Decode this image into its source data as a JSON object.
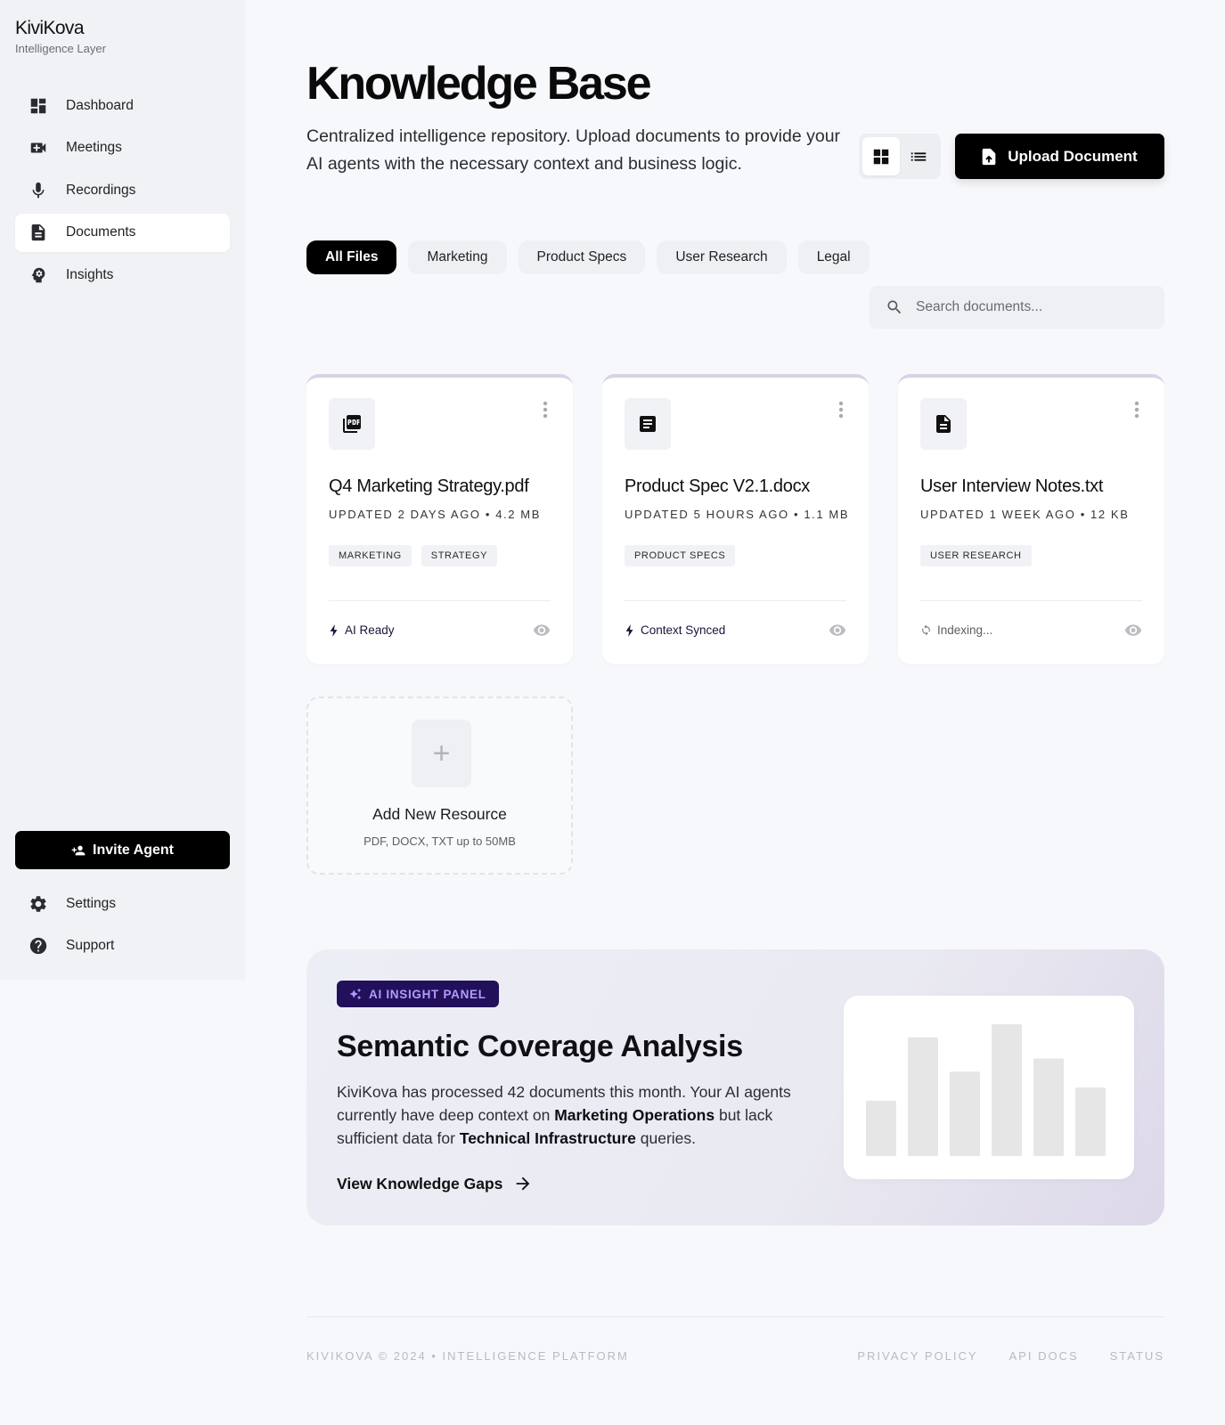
{
  "brand": {
    "name": "KiviKova",
    "tagline": "Intelligence Layer"
  },
  "sidebar": {
    "items": [
      {
        "label": "Dashboard",
        "icon": "dashboard-icon"
      },
      {
        "label": "Meetings",
        "icon": "video-icon"
      },
      {
        "label": "Recordings",
        "icon": "microphone-icon"
      },
      {
        "label": "Documents",
        "icon": "document-icon",
        "active": true
      },
      {
        "label": "Insights",
        "icon": "insights-icon"
      }
    ],
    "invite_label": "Invite Agent",
    "bottom_items": [
      {
        "label": "Settings",
        "icon": "gear-icon"
      },
      {
        "label": "Support",
        "icon": "help-icon"
      }
    ]
  },
  "header": {
    "title": "Knowledge Base",
    "subtitle": "Centralized intelligence repository. Upload documents to provide your AI agents with the necessary context and business logic.",
    "view_mode": "grid",
    "upload_label": "Upload Document"
  },
  "filters": [
    "All Files",
    "Marketing",
    "Product Specs",
    "User Research",
    "Legal"
  ],
  "active_filter": "All Files",
  "search": {
    "placeholder": "Search documents...",
    "value": ""
  },
  "documents": [
    {
      "name": "Q4 Marketing Strategy.pdf",
      "meta": "UPDATED 2 DAYS AGO • 4.2 MB",
      "icon": "pdf-icon",
      "tags": [
        "MARKETING",
        "STRATEGY"
      ],
      "status": "AI Ready",
      "status_icon": "bolt-icon"
    },
    {
      "name": "Product Spec V2.1.docx",
      "meta": "UPDATED 5 HOURS AGO • 1.1 MB",
      "icon": "article-icon",
      "tags": [
        "PRODUCT SPECS"
      ],
      "status": "Context Synced",
      "status_icon": "bolt-icon"
    },
    {
      "name": "User Interview Notes.txt",
      "meta": "UPDATED 1 WEEK AGO • 12 KB",
      "icon": "text-file-icon",
      "tags": [
        "USER RESEARCH"
      ],
      "status": "Indexing...",
      "status_icon": "sync-icon"
    }
  ],
  "add_resource": {
    "title": "Add New Resource",
    "subtitle": "PDF, DOCX, TXT up to 50MB"
  },
  "insight": {
    "badge": "AI INSIGHT PANEL",
    "title": "Semantic Coverage Analysis",
    "body_1": "KiviKova has processed 42 documents this month. Your AI agents currently have deep context on ",
    "body_bold_1": "Marketing Operations",
    "body_2": " but lack sufficient data for ",
    "body_bold_2": "Technical Infrastructure",
    "body_3": " queries.",
    "link": "View Knowledge Gaps",
    "chart_values": [
      0.42,
      0.9,
      0.64,
      1.0,
      0.74,
      0.52
    ],
    "bar_color": "#e6e6e6"
  },
  "footer": {
    "left": "KIVIKOVA © 2024 • INTELLIGENCE PLATFORM",
    "links": [
      "PRIVACY POLICY",
      "API DOCS",
      "STATUS"
    ]
  },
  "colors": {
    "accent": "#000000",
    "card_top_border": "#d9d2e6",
    "badge_bg": "#22105a",
    "badge_text": "#b19cff"
  }
}
